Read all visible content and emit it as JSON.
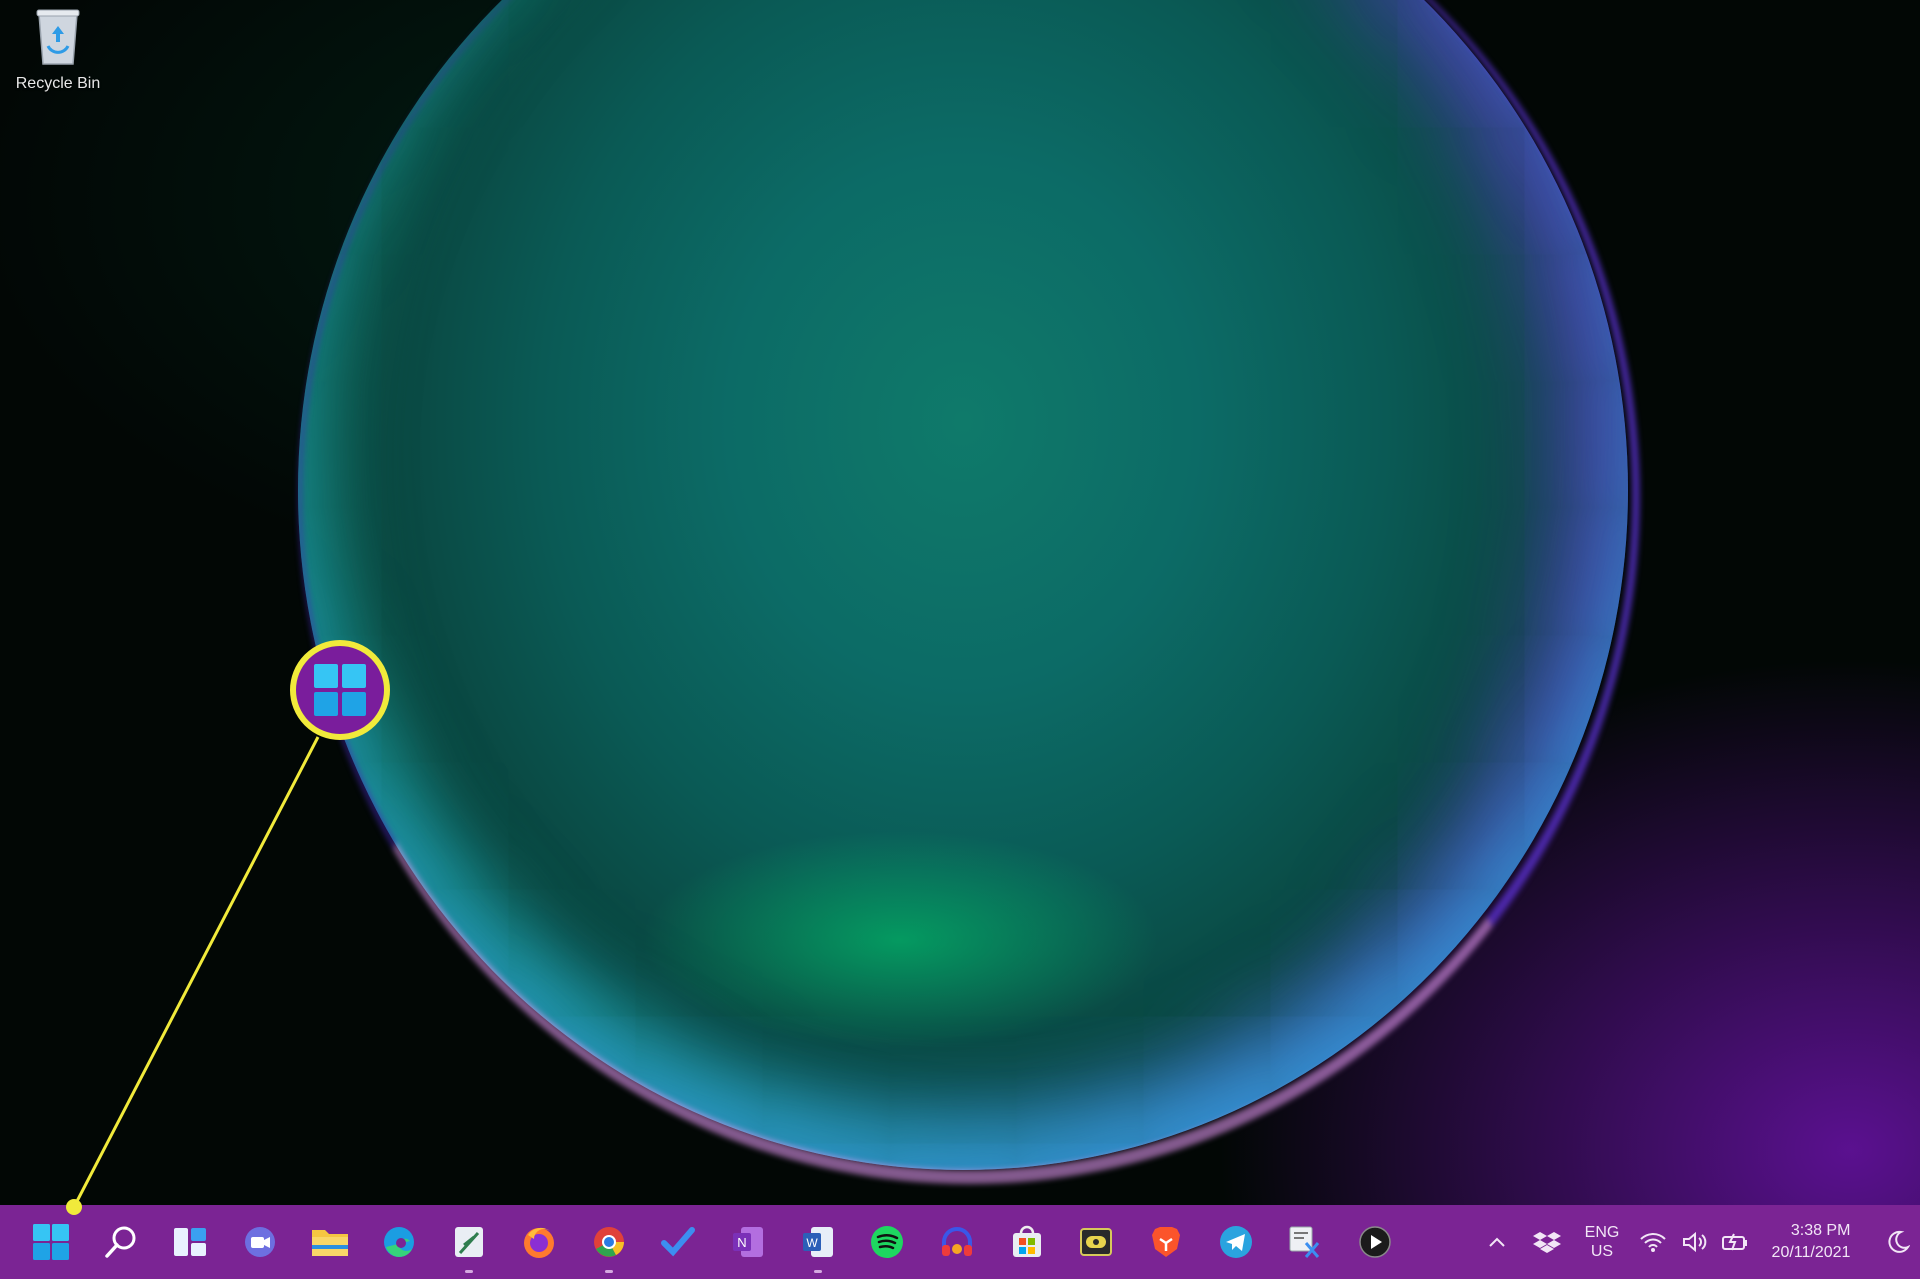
{
  "desktop": {
    "recycle_bin_label": "Recycle Bin"
  },
  "callout": {
    "icon": "windows-start-icon",
    "color": "#f1ea3b"
  },
  "taskbar": {
    "background": "#7b2494",
    "apps": [
      {
        "name": "start",
        "icon": "windows-start-icon"
      },
      {
        "name": "search",
        "icon": "search-icon"
      },
      {
        "name": "widgets",
        "icon": "widgets-icon"
      },
      {
        "name": "teams-chat",
        "icon": "chat-camera-icon"
      },
      {
        "name": "file-explorer",
        "icon": "folder-icon"
      },
      {
        "name": "edge",
        "icon": "edge-icon"
      },
      {
        "name": "app-7",
        "icon": "feather-app-icon"
      },
      {
        "name": "firefox",
        "icon": "firefox-icon"
      },
      {
        "name": "chrome",
        "icon": "chrome-icon"
      },
      {
        "name": "todo",
        "icon": "checkmark-icon"
      },
      {
        "name": "onenote",
        "icon": "onenote-icon"
      },
      {
        "name": "word",
        "icon": "word-icon"
      },
      {
        "name": "spotify",
        "icon": "spotify-icon"
      },
      {
        "name": "headphones-app",
        "icon": "headphones-icon"
      },
      {
        "name": "store",
        "icon": "store-icon"
      },
      {
        "name": "media-app",
        "icon": "media-icon"
      },
      {
        "name": "brave",
        "icon": "brave-icon"
      },
      {
        "name": "telegram",
        "icon": "telegram-icon"
      },
      {
        "name": "snipping-tool",
        "icon": "snip-icon"
      },
      {
        "name": "media-player",
        "icon": "play-circle-icon"
      }
    ],
    "tray": {
      "lang_line1": "ENG",
      "lang_line2": "US",
      "time": "3:38 PM",
      "date": "20/11/2021"
    }
  }
}
